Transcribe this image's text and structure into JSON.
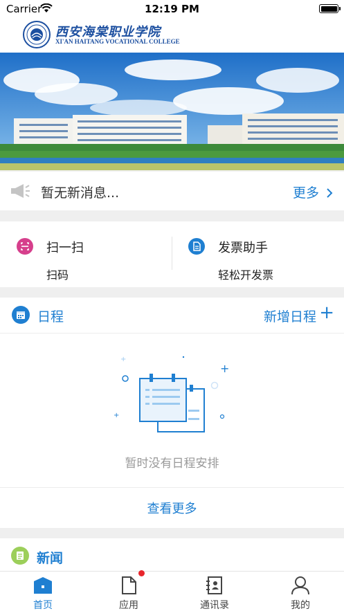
{
  "status_bar": {
    "carrier": "Carrier",
    "time": "12:19 PM"
  },
  "header": {
    "college_name_cn": "西安海棠职业学院",
    "college_name_en": "XI'AN HAITANG VOCATIONAL COLLEGE"
  },
  "notice": {
    "text": "暂无新消息...",
    "more_label": "更多"
  },
  "quick_actions": [
    {
      "title": "扫一扫",
      "subtitle": "扫码",
      "icon": "scan-icon",
      "color": "#d63f8c"
    },
    {
      "title": "发票助手",
      "subtitle": "轻松开发票",
      "icon": "invoice-icon",
      "color": "#1f7fd1"
    }
  ],
  "schedule": {
    "title": "日程",
    "add_label": "新增日程",
    "add_symbol": "+",
    "empty_text": "暂时没有日程安排",
    "view_more": "查看更多"
  },
  "news": {
    "title": "新闻"
  },
  "tabbar": {
    "tabs": [
      {
        "label": "首页",
        "icon": "home-icon",
        "active": true
      },
      {
        "label": "应用",
        "icon": "apps-icon",
        "badge": true
      },
      {
        "label": "通讯录",
        "icon": "contacts-icon"
      },
      {
        "label": "我的",
        "icon": "profile-icon"
      }
    ]
  },
  "colors": {
    "accent": "#1f7fd1",
    "badge": "#e8262c",
    "news_icon": "#9ccf5a"
  }
}
